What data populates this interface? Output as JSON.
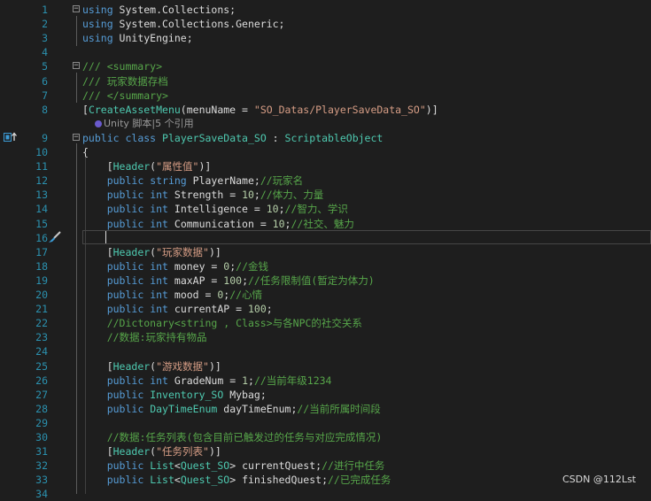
{
  "editor": {
    "gutter": {
      "bookmark_icon": "bookmark-arrow-icon",
      "brush_icon": "quick-action-brush-icon"
    },
    "codelens": "Unity 脚本|5 个引用",
    "lines": [
      {
        "n": "1",
        "t": [
          [
            "kw",
            "using"
          ],
          [
            "plain",
            " System.Collections;"
          ]
        ]
      },
      {
        "n": "2",
        "t": [
          [
            "kw",
            "using"
          ],
          [
            "plain",
            " System.Collections.Generic;"
          ]
        ]
      },
      {
        "n": "3",
        "t": [
          [
            "kw",
            "using"
          ],
          [
            "plain",
            " UnityEngine;"
          ]
        ]
      },
      {
        "n": "4",
        "t": []
      },
      {
        "n": "5",
        "t": [
          [
            "cm",
            "/// <summary>"
          ]
        ]
      },
      {
        "n": "6",
        "t": [
          [
            "cm",
            "/// 玩家数据存档"
          ]
        ]
      },
      {
        "n": "7",
        "t": [
          [
            "cm",
            "/// </summary>"
          ]
        ]
      },
      {
        "n": "8",
        "t": [
          [
            "plain",
            "["
          ],
          [
            "ty",
            "CreateAssetMenu"
          ],
          [
            "plain",
            "(menuName = "
          ],
          [
            "str",
            "\"SO_Datas/PlayerSaveData_SO\""
          ],
          [
            "plain",
            ")]"
          ]
        ]
      },
      {
        "n": "9",
        "t": [
          [
            "kw",
            "public"
          ],
          [
            "plain",
            " "
          ],
          [
            "kw",
            "class"
          ],
          [
            "plain",
            " "
          ],
          [
            "ty",
            "PlayerSaveData_SO"
          ],
          [
            "plain",
            " : "
          ],
          [
            "ty",
            "ScriptableObject"
          ]
        ]
      },
      {
        "n": "10",
        "t": [
          [
            "plain",
            "{"
          ]
        ]
      },
      {
        "n": "11",
        "t": [
          [
            "plain",
            "    ["
          ],
          [
            "ty",
            "Header"
          ],
          [
            "plain",
            "("
          ],
          [
            "str",
            "\"属性值\""
          ],
          [
            "plain",
            ")]"
          ]
        ]
      },
      {
        "n": "12",
        "t": [
          [
            "plain",
            "    "
          ],
          [
            "kw",
            "public"
          ],
          [
            "plain",
            " "
          ],
          [
            "kw",
            "string"
          ],
          [
            "plain",
            " PlayerName;"
          ],
          [
            "cm",
            "//玩家名"
          ]
        ]
      },
      {
        "n": "13",
        "t": [
          [
            "plain",
            "    "
          ],
          [
            "kw",
            "public"
          ],
          [
            "plain",
            " "
          ],
          [
            "kw",
            "int"
          ],
          [
            "plain",
            " Strength = "
          ],
          [
            "num",
            "10"
          ],
          [
            "plain",
            ";"
          ],
          [
            "cm",
            "//体力、力量"
          ]
        ]
      },
      {
        "n": "14",
        "t": [
          [
            "plain",
            "    "
          ],
          [
            "kw",
            "public"
          ],
          [
            "plain",
            " "
          ],
          [
            "kw",
            "int"
          ],
          [
            "plain",
            " Intelligence = "
          ],
          [
            "num",
            "10"
          ],
          [
            "plain",
            ";"
          ],
          [
            "cm",
            "//智力、学识"
          ]
        ]
      },
      {
        "n": "15",
        "t": [
          [
            "plain",
            "    "
          ],
          [
            "kw",
            "public"
          ],
          [
            "plain",
            " "
          ],
          [
            "kw",
            "int"
          ],
          [
            "plain",
            " Communication = "
          ],
          [
            "num",
            "10"
          ],
          [
            "plain",
            ";"
          ],
          [
            "cm",
            "//社交、魅力"
          ]
        ]
      },
      {
        "n": "16",
        "t": []
      },
      {
        "n": "17",
        "t": [
          [
            "plain",
            "    ["
          ],
          [
            "ty",
            "Header"
          ],
          [
            "plain",
            "("
          ],
          [
            "str",
            "\"玩家数据\""
          ],
          [
            "plain",
            ")]"
          ]
        ]
      },
      {
        "n": "18",
        "t": [
          [
            "plain",
            "    "
          ],
          [
            "kw",
            "public"
          ],
          [
            "plain",
            " "
          ],
          [
            "kw",
            "int"
          ],
          [
            "plain",
            " money = "
          ],
          [
            "num",
            "0"
          ],
          [
            "plain",
            ";"
          ],
          [
            "cm",
            "//金钱"
          ]
        ]
      },
      {
        "n": "19",
        "t": [
          [
            "plain",
            "    "
          ],
          [
            "kw",
            "public"
          ],
          [
            "plain",
            " "
          ],
          [
            "kw",
            "int"
          ],
          [
            "plain",
            " maxAP = "
          ],
          [
            "num",
            "100"
          ],
          [
            "plain",
            ";"
          ],
          [
            "cm",
            "//任务限制值(暂定为体力)"
          ]
        ]
      },
      {
        "n": "20",
        "t": [
          [
            "plain",
            "    "
          ],
          [
            "kw",
            "public"
          ],
          [
            "plain",
            " "
          ],
          [
            "kw",
            "int"
          ],
          [
            "plain",
            " mood = "
          ],
          [
            "num",
            "0"
          ],
          [
            "plain",
            ";"
          ],
          [
            "cm",
            "//心情"
          ]
        ]
      },
      {
        "n": "21",
        "t": [
          [
            "plain",
            "    "
          ],
          [
            "kw",
            "public"
          ],
          [
            "plain",
            " "
          ],
          [
            "kw",
            "int"
          ],
          [
            "plain",
            " currentAP = "
          ],
          [
            "num",
            "100"
          ],
          [
            "plain",
            ";"
          ]
        ]
      },
      {
        "n": "22",
        "t": [
          [
            "plain",
            "    "
          ],
          [
            "cm",
            "//Dictonary<string , Class>与各NPC的社交关系"
          ]
        ]
      },
      {
        "n": "23",
        "t": [
          [
            "plain",
            "    "
          ],
          [
            "cm",
            "//数据:玩家持有物品"
          ]
        ]
      },
      {
        "n": "24",
        "t": []
      },
      {
        "n": "25",
        "t": [
          [
            "plain",
            "    ["
          ],
          [
            "ty",
            "Header"
          ],
          [
            "plain",
            "("
          ],
          [
            "str",
            "\"游戏数据\""
          ],
          [
            "plain",
            ")]"
          ]
        ]
      },
      {
        "n": "26",
        "t": [
          [
            "plain",
            "    "
          ],
          [
            "kw",
            "public"
          ],
          [
            "plain",
            " "
          ],
          [
            "kw",
            "int"
          ],
          [
            "plain",
            " GradeNum = "
          ],
          [
            "num",
            "1"
          ],
          [
            "plain",
            ";"
          ],
          [
            "cm",
            "//当前年级1234"
          ]
        ]
      },
      {
        "n": "27",
        "t": [
          [
            "plain",
            "    "
          ],
          [
            "kw",
            "public"
          ],
          [
            "plain",
            " "
          ],
          [
            "ty",
            "Inventory_SO"
          ],
          [
            "plain",
            " Mybag;"
          ]
        ]
      },
      {
        "n": "28",
        "t": [
          [
            "plain",
            "    "
          ],
          [
            "kw",
            "public"
          ],
          [
            "plain",
            " "
          ],
          [
            "ty",
            "DayTimeEnum"
          ],
          [
            "plain",
            " dayTimeEnum;"
          ],
          [
            "cm",
            "//当前所属时间段"
          ]
        ]
      },
      {
        "n": "29",
        "t": []
      },
      {
        "n": "30",
        "t": [
          [
            "plain",
            "    "
          ],
          [
            "cm",
            "//数据:任务列表(包含目前已触发过的任务与对应完成情况)"
          ]
        ]
      },
      {
        "n": "31",
        "t": [
          [
            "plain",
            "    ["
          ],
          [
            "ty",
            "Header"
          ],
          [
            "plain",
            "("
          ],
          [
            "str",
            "\"任务列表\""
          ],
          [
            "plain",
            ")]"
          ]
        ]
      },
      {
        "n": "32",
        "t": [
          [
            "plain",
            "    "
          ],
          [
            "kw",
            "public"
          ],
          [
            "plain",
            " "
          ],
          [
            "ty",
            "List"
          ],
          [
            "plain",
            "<"
          ],
          [
            "ty",
            "Quest_SO"
          ],
          [
            "plain",
            "> currentQuest;"
          ],
          [
            "cm",
            "//进行中任务"
          ]
        ]
      },
      {
        "n": "33",
        "t": [
          [
            "plain",
            "    "
          ],
          [
            "kw",
            "public"
          ],
          [
            "plain",
            " "
          ],
          [
            "ty",
            "List"
          ],
          [
            "plain",
            "<"
          ],
          [
            "ty",
            "Quest_SO"
          ],
          [
            "plain",
            "> finishedQuest;"
          ],
          [
            "cm",
            "//已完成任务"
          ]
        ]
      },
      {
        "n": "34",
        "t": []
      }
    ]
  },
  "watermark": "CSDN @112Lst"
}
